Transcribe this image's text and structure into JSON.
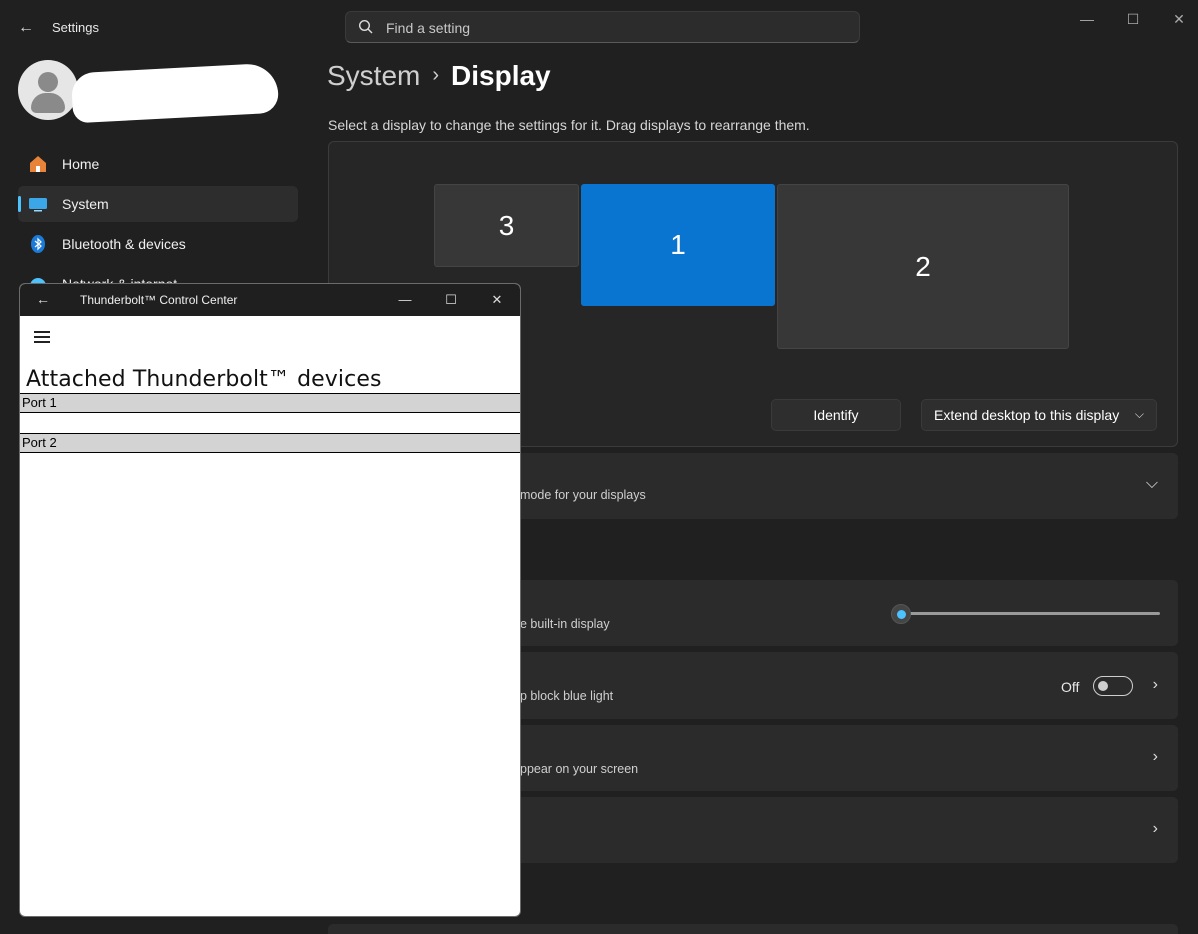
{
  "settings": {
    "window_title": "Settings",
    "search_placeholder": "Find a setting",
    "sidebar": {
      "items": [
        {
          "label": "Home"
        },
        {
          "label": "System"
        },
        {
          "label": "Bluetooth & devices"
        },
        {
          "label": "Network & internet"
        }
      ]
    },
    "breadcrumb": {
      "parent": "System",
      "current": "Display"
    },
    "arrange_instructions": "Select a display to change the settings for it. Drag displays to rearrange them.",
    "monitors": [
      {
        "label": "3"
      },
      {
        "label": "1"
      },
      {
        "label": "2"
      }
    ],
    "identify_label": "Identify",
    "extend_label": "Extend desktop to this display",
    "cards": {
      "hdr_sub": "mode for your displays",
      "brightness_sub": "e built-in display",
      "night_light_sub": "p block blue light",
      "night_light_state": "Off",
      "scale_sub": "ppear on your screen"
    },
    "colors": {
      "accent": "#0a74d1",
      "toggle_thumb": "#4cc2ff",
      "background": "#202020"
    }
  },
  "thunderbolt": {
    "title": "Thunderbolt™ Control Center",
    "heading": "Attached  Thunderbolt™ devices",
    "ports": [
      {
        "label": "Port  1"
      },
      {
        "label": "Port  2"
      }
    ]
  }
}
